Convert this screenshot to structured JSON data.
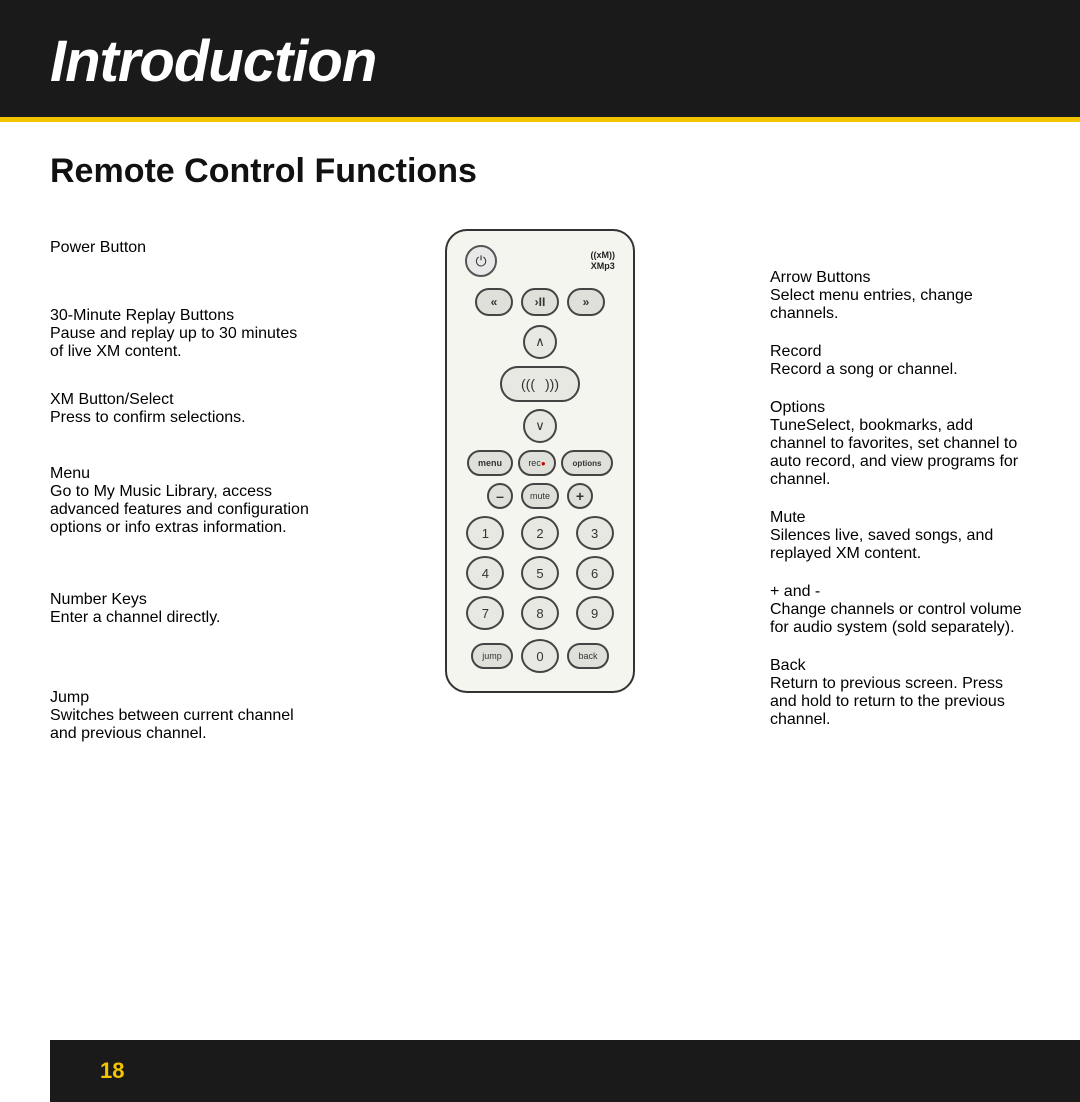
{
  "header": {
    "title": "Introduction"
  },
  "section": {
    "title": "Remote Control Functions"
  },
  "left_labels": [
    {
      "id": "power-button",
      "title": "Power Button",
      "desc": ""
    },
    {
      "id": "replay-buttons",
      "title": "30-Minute Replay Buttons",
      "desc": "Pause and replay up to 30 minutes of live XM content."
    },
    {
      "id": "xm-button",
      "title": "XM Button/Select",
      "desc": "Press to confirm selections."
    },
    {
      "id": "menu",
      "title": "Menu",
      "desc": "Go to My Music Library, access advanced features and configuration options or info extras information."
    },
    {
      "id": "number-keys",
      "title": "Number Keys",
      "desc": "Enter a channel directly."
    },
    {
      "id": "jump",
      "title": "Jump",
      "desc": "Switches between current channel and previous channel."
    }
  ],
  "right_labels": [
    {
      "id": "arrow-buttons",
      "title": "Arrow Buttons",
      "desc": "Select menu entries, change channels."
    },
    {
      "id": "record",
      "title": "Record",
      "desc": "Record a song or channel."
    },
    {
      "id": "options",
      "title": "Options",
      "desc": "TuneSelect, bookmarks, add channel to favorites, set channel to auto record, and view programs for channel."
    },
    {
      "id": "mute",
      "title": "Mute",
      "desc": "Silences live, saved songs, and replayed XM content."
    },
    {
      "id": "plus-minus",
      "title": "+ and -",
      "desc": "Change channels or control volume for audio system (sold separately)."
    },
    {
      "id": "back",
      "title": "Back",
      "desc": "Return to previous screen. Press and hold to return to the previous channel."
    }
  ],
  "remote": {
    "xm_label": "((xM))",
    "xmp3_label": "XMp3",
    "buttons": {
      "transport": [
        "«",
        "›II",
        "»"
      ],
      "numbers": [
        "1",
        "2",
        "3",
        "4",
        "5",
        "6",
        "7",
        "8",
        "9",
        "0"
      ],
      "menu": "menu",
      "rec": "rec",
      "options": "options",
      "minus": "–",
      "mute": "mute",
      "plus": "+",
      "jump": "jump",
      "back": "back"
    }
  },
  "footer": {
    "page_number": "18"
  }
}
